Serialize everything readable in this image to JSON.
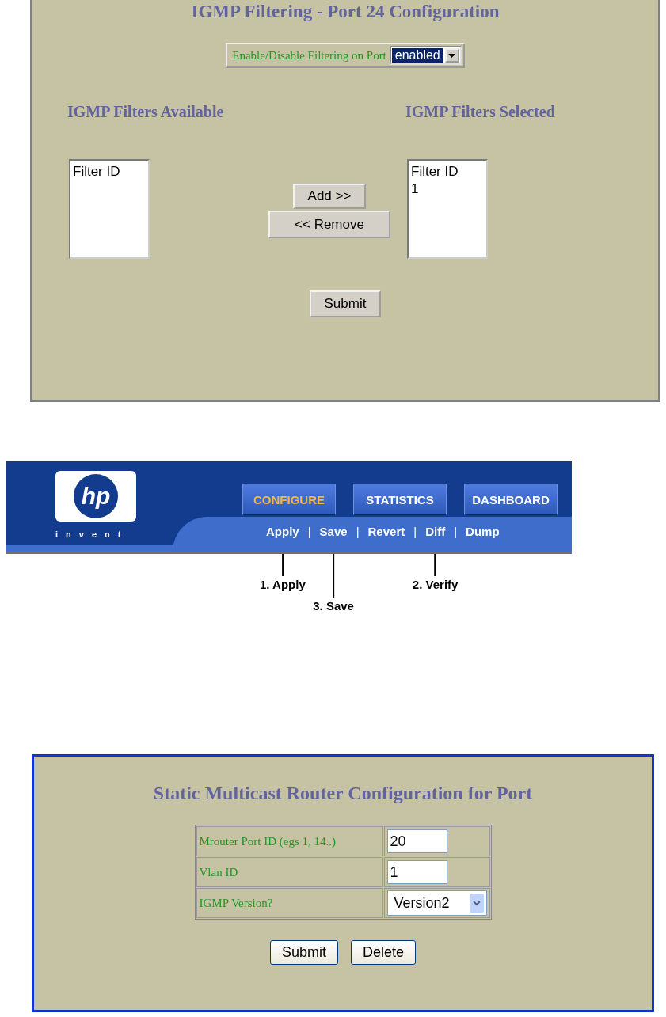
{
  "igmp_filtering": {
    "title": "IGMP Filtering - Port 24 Configuration",
    "enable_label": "Enable/Disable Filtering on Port",
    "enable_select": {
      "value": "enabled"
    },
    "available": {
      "heading": "IGMP Filters Available",
      "items": [
        "Filter ID"
      ]
    },
    "selected": {
      "heading": "IGMP Filters Selected",
      "items": [
        "Filter ID",
        "1"
      ]
    },
    "move_buttons": [
      "Add >>",
      "<< Remove"
    ],
    "submit": "Submit"
  },
  "banner": {
    "logo_mark": "hp",
    "logo_text": "invent",
    "tabs": [
      {
        "label": "CONFIGURE",
        "selected": true
      },
      {
        "label": "STATISTICS",
        "selected": false
      },
      {
        "label": "DASHBOARD",
        "selected": false
      }
    ],
    "links": [
      {
        "kind": "link",
        "label": "Apply",
        "callout": {
          "text": "1. Apply",
          "lowered": false
        }
      },
      {
        "kind": "separator",
        "label": "|"
      },
      {
        "kind": "link",
        "label": "Save",
        "callout": {
          "text": "3. Save",
          "lowered": true
        }
      },
      {
        "kind": "separator",
        "label": "|"
      },
      {
        "kind": "link",
        "label": "Revert"
      },
      {
        "kind": "separator",
        "label": "|"
      },
      {
        "kind": "link",
        "label": "Diff",
        "callout": {
          "text": "2. Verify",
          "lowered": false
        }
      },
      {
        "kind": "separator",
        "label": "|"
      },
      {
        "kind": "link",
        "label": "Dump"
      }
    ]
  },
  "static_mrouter": {
    "title": "Static Multicast Router Configuration for Port",
    "rows": [
      {
        "kind": "input",
        "label": "Mrouter Port ID (egs 1, 14..)",
        "value": "20"
      },
      {
        "kind": "input",
        "label": "Vlan ID",
        "value": "1"
      },
      {
        "kind": "select",
        "label": "IGMP Version?",
        "value": "Version2"
      }
    ],
    "buttons": [
      "Submit",
      "Delete"
    ]
  }
}
